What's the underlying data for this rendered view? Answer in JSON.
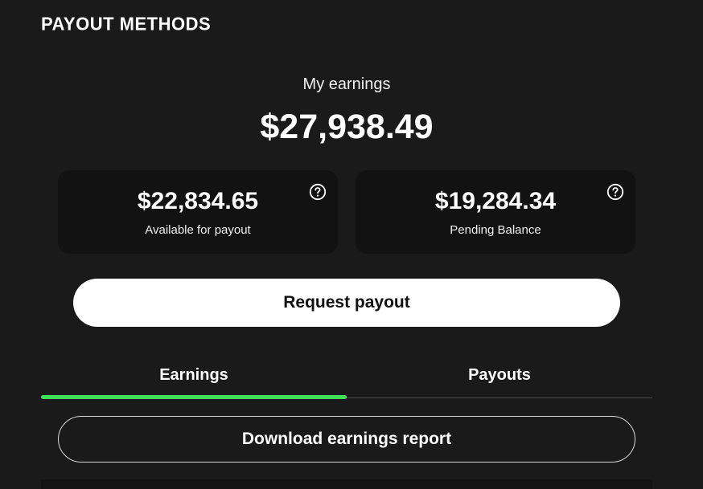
{
  "page": {
    "title": "PAYOUT METHODS"
  },
  "earnings": {
    "label": "My earnings",
    "total": "$27,938.49"
  },
  "cards": [
    {
      "amount": "$22,834.65",
      "caption": "Available for payout",
      "icon": "help-circle-icon"
    },
    {
      "amount": "$19,284.34",
      "caption": "Pending Balance",
      "icon": "help-circle-icon"
    }
  ],
  "actions": {
    "request_payout": "Request payout",
    "download_report": "Download earnings report"
  },
  "tabs": [
    {
      "label": "Earnings",
      "active": true
    },
    {
      "label": "Payouts",
      "active": false
    }
  ],
  "colors": {
    "background": "#1a1a1a",
    "card": "#121212",
    "accent": "#3ee05a",
    "primary_button": "#ffffff"
  }
}
